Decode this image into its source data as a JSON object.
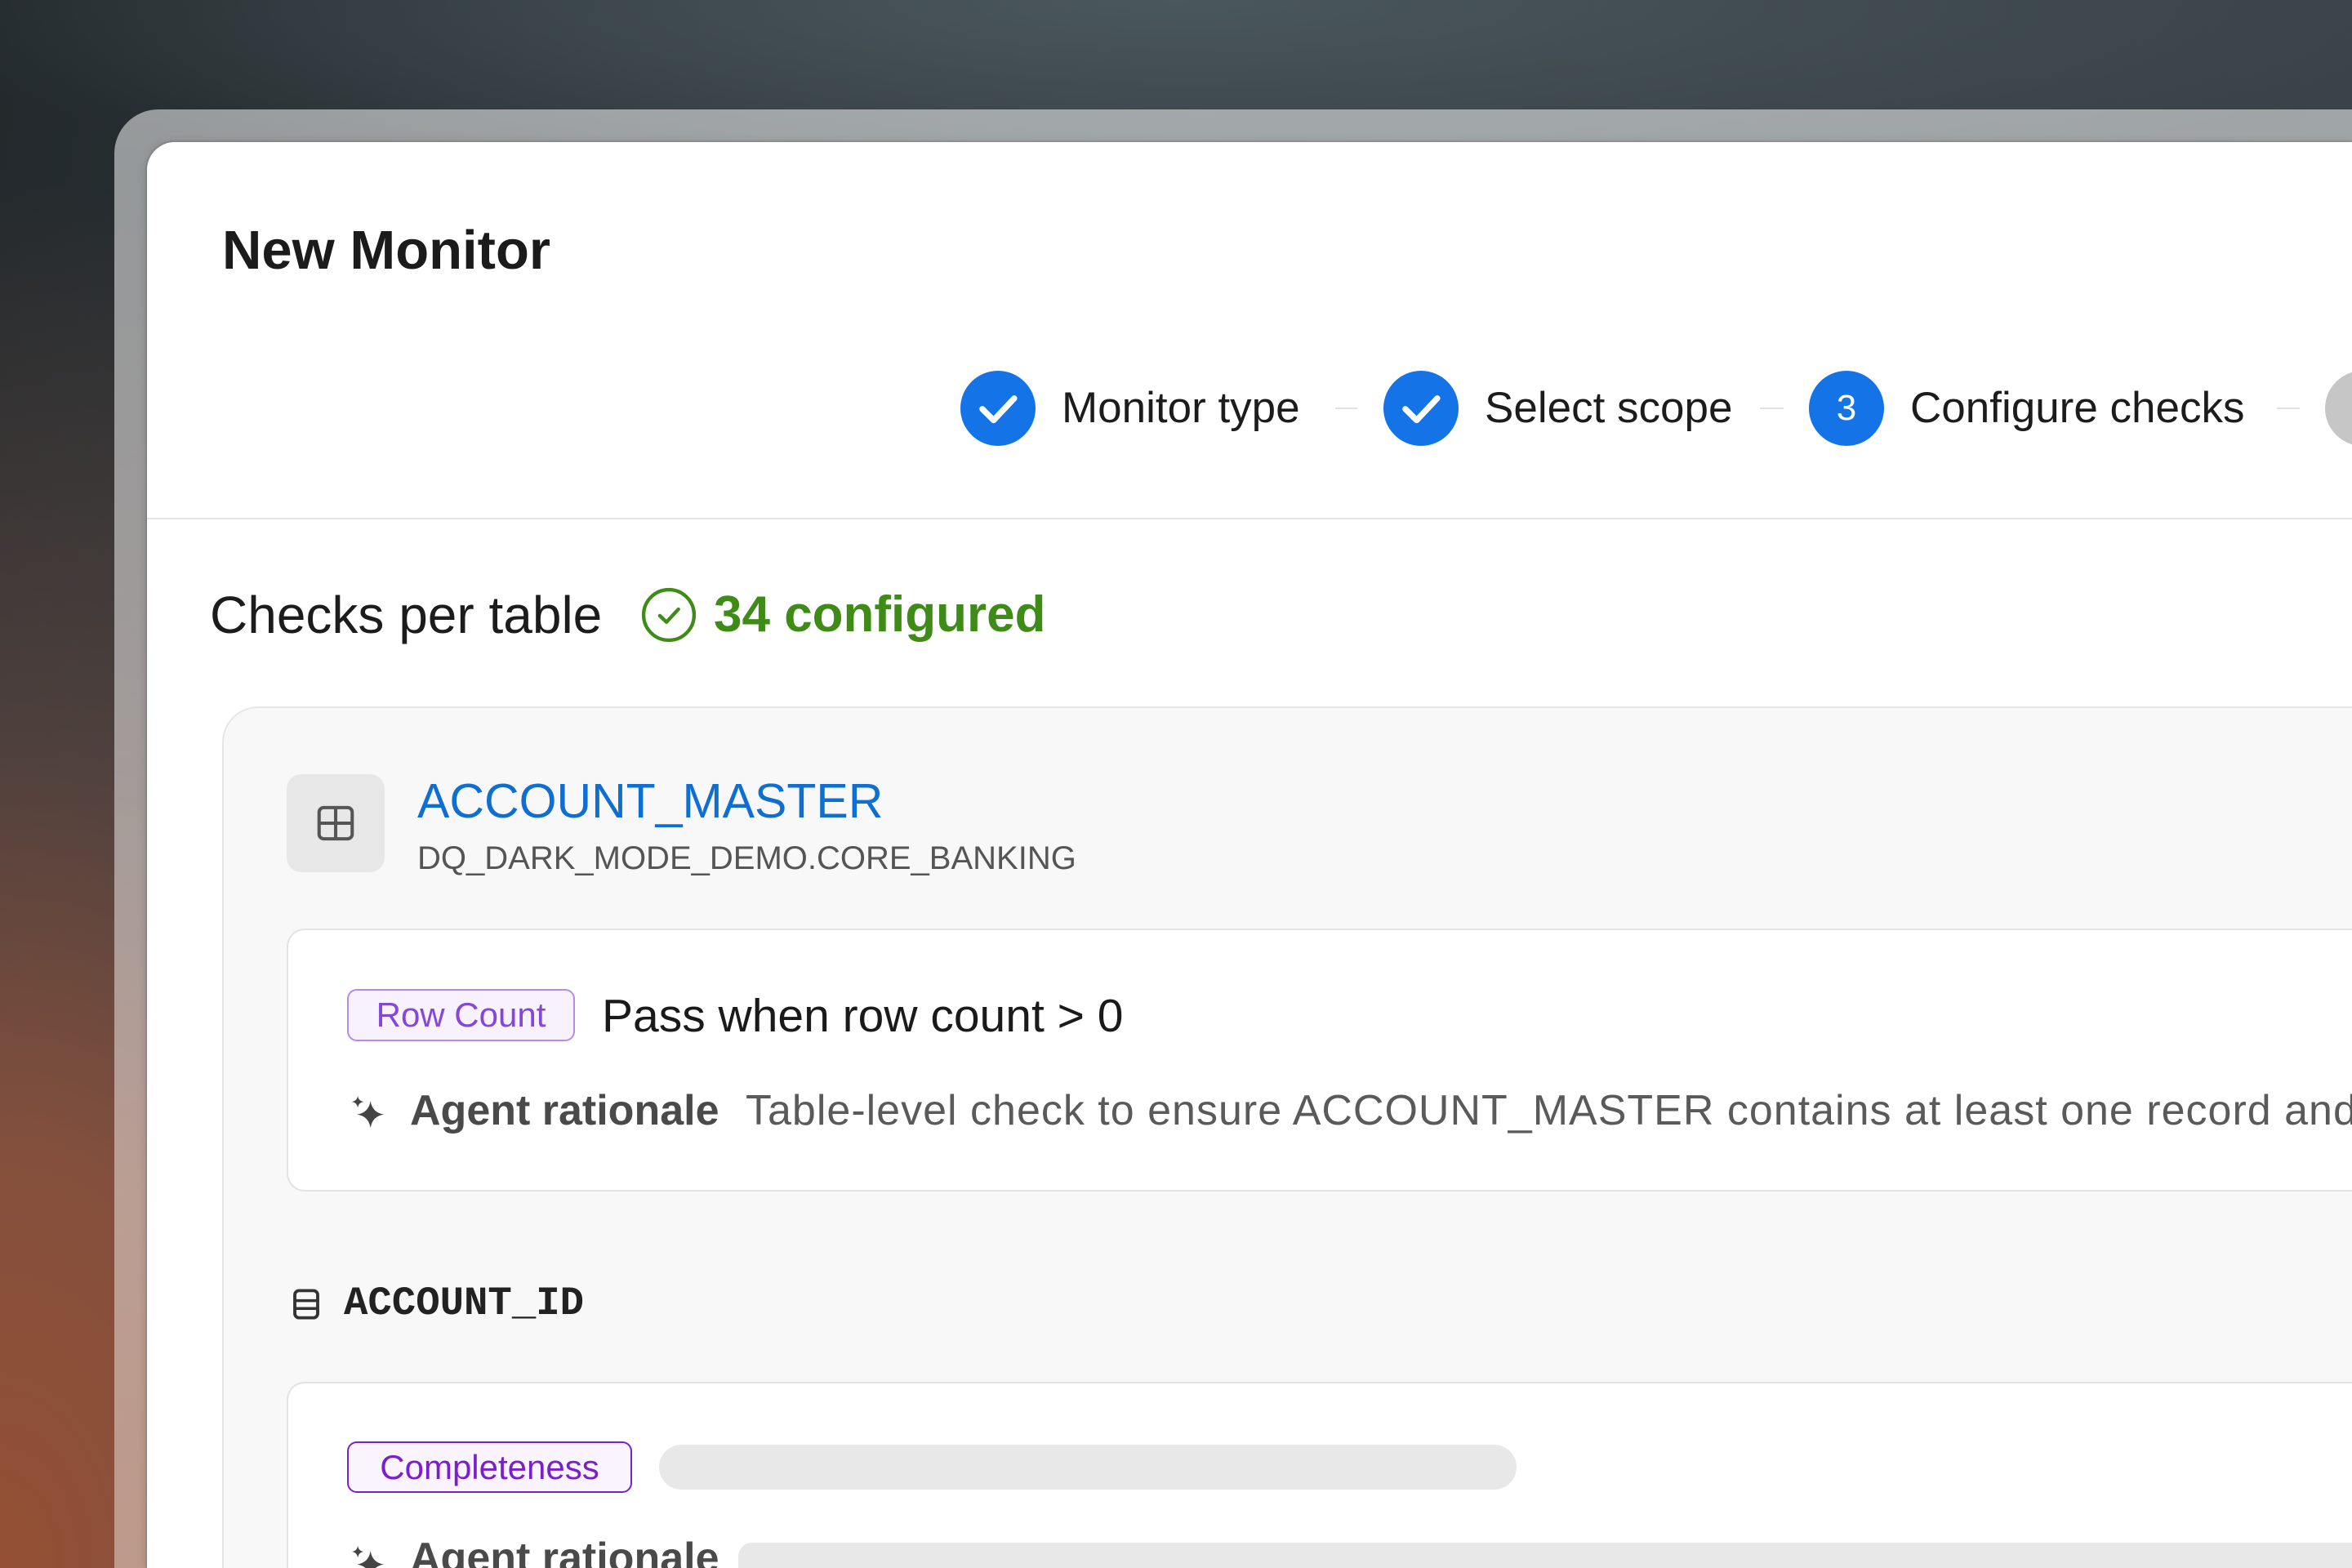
{
  "colors": {
    "primary": "#1473e6",
    "step_pending": "#c6c6c6",
    "success": "#3f8b17",
    "link": "#0f6fd1",
    "row_count_badge": "#8447d8",
    "completeness_badge": "#7a1fc9"
  },
  "dialog": {
    "title": "New Monitor"
  },
  "stepper": {
    "steps": [
      {
        "icon": "check-icon",
        "label": "Monitor type"
      },
      {
        "icon": "check-icon",
        "label": "Select scope"
      },
      {
        "number": "3",
        "label": "Configure checks"
      },
      {
        "icon": "pending-step-icon"
      }
    ]
  },
  "checks_summary": {
    "heading": "Checks per table",
    "status_icon": "check-circle-icon",
    "configured": "34 configured"
  },
  "tables": [
    {
      "icon": "table-icon",
      "name": "ACCOUNT_MASTER",
      "path": "DQ_DARK_MODE_DEMO.CORE_BANKING",
      "table_checks": [
        {
          "type": "Row Count",
          "condition": "Pass when row count > 0",
          "rationale_icon": "sparkle-icon",
          "rationale_label": "Agent rationale",
          "rationale": "Table-level check to ensure ACCOUNT_MASTER contains at least one record and"
        }
      ],
      "columns": [
        {
          "icon": "column-icon",
          "name": "ACCOUNT_ID",
          "checks": [
            {
              "type": "Completeness",
              "rationale_icon": "sparkle-icon",
              "rationale_label": "Agent rationale"
            }
          ]
        }
      ]
    }
  ]
}
